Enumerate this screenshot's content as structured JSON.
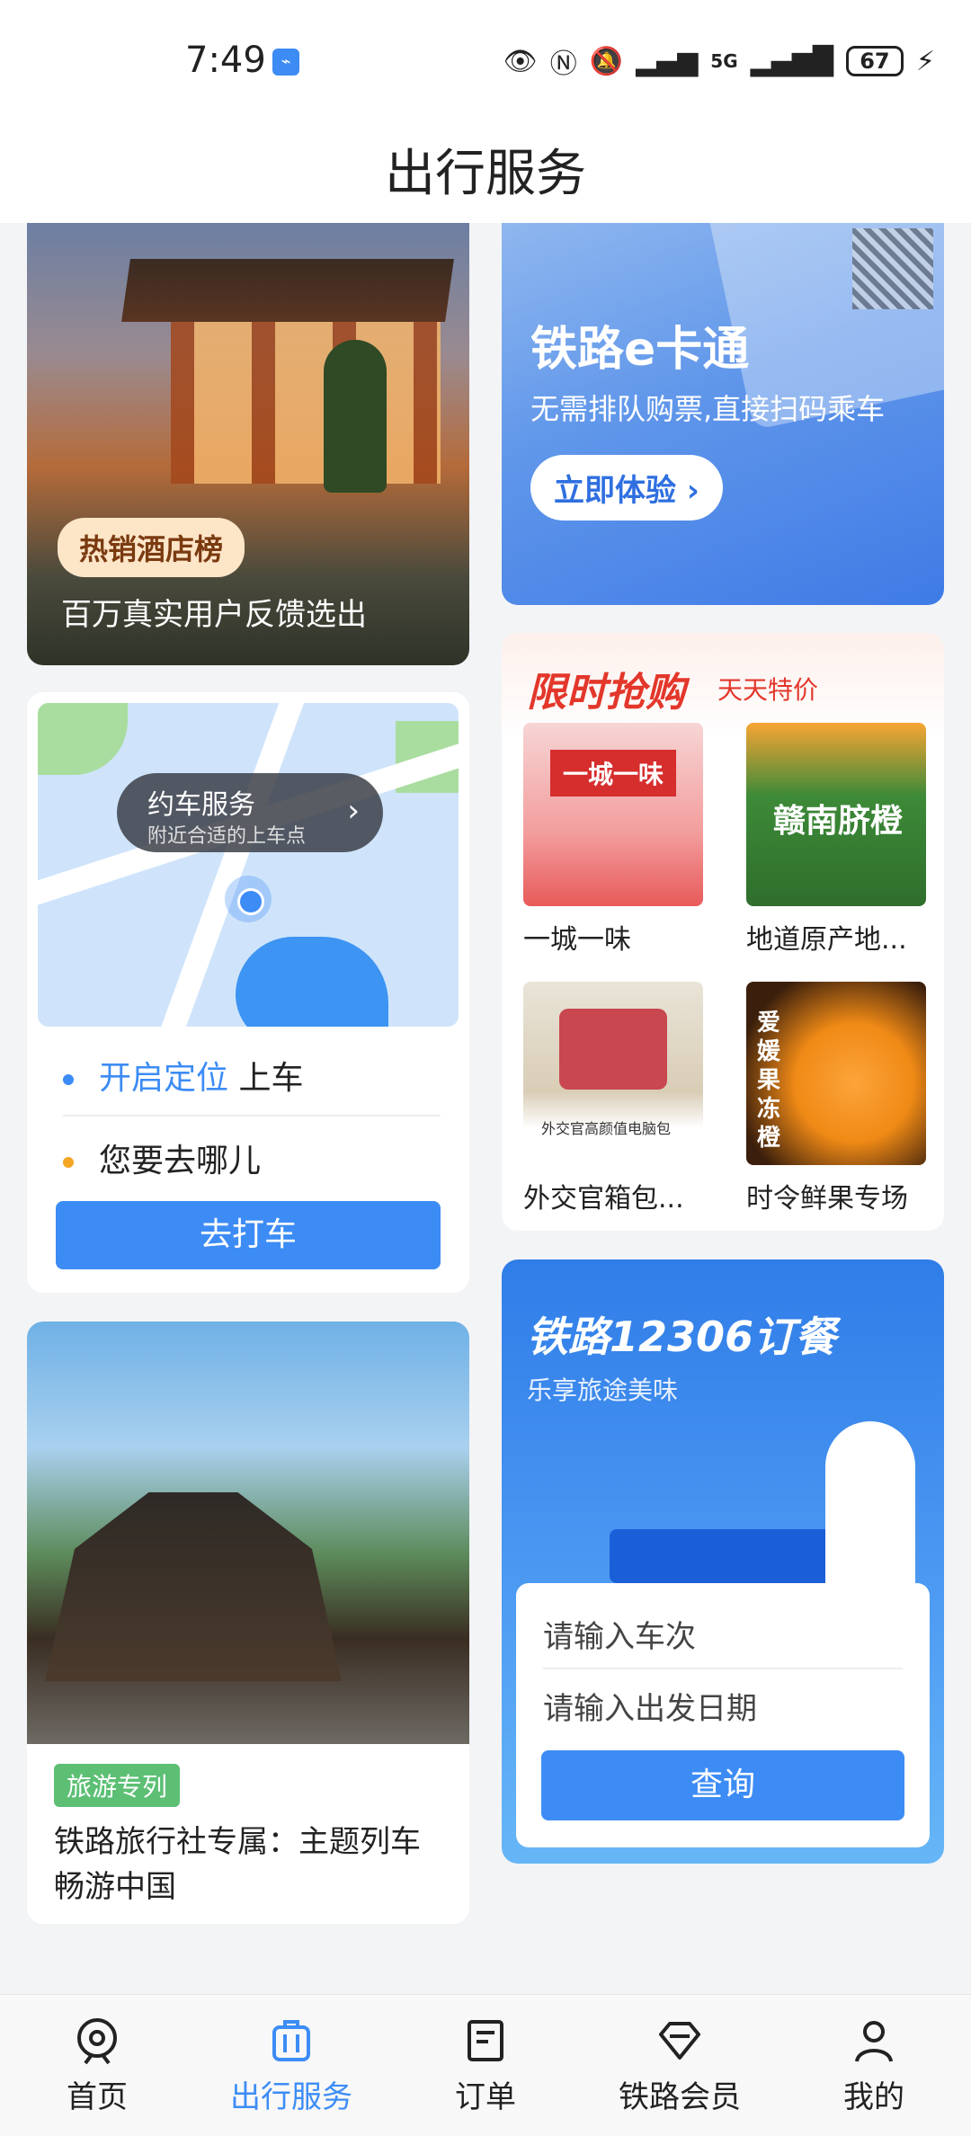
{
  "status": {
    "time": "7:49",
    "network": "5G",
    "battery": "67"
  },
  "header": {
    "title": "出行服务"
  },
  "hotel": {
    "badge": "热销酒店榜",
    "subtitle": "百万真实用户反馈选出"
  },
  "ecard": {
    "title": "铁路e卡通",
    "subtitle": "无需排队购票,直接扫码乘车",
    "button": "立即体验"
  },
  "taxi": {
    "bubble_title": "约车服务",
    "bubble_sub": "附近合适的上车点",
    "locate_link": "开启定位",
    "locate_suffix": "上车",
    "destination": "您要去哪儿",
    "button": "去打车"
  },
  "flash": {
    "title": "限时抢购",
    "tag": "天天特价",
    "products": [
      {
        "name": "一城一味",
        "img_text": "一城一味"
      },
      {
        "name": "地道原产地...",
        "img_text": "赣南脐橙"
      },
      {
        "name": "外交官箱包...",
        "img_text": "外交官高颜值电脑包"
      },
      {
        "name": "时令鲜果专场",
        "img_text": "爱媛果冻橙"
      }
    ]
  },
  "tour": {
    "tag": "旅游专列",
    "text": "铁路旅行社专属：主题列车畅游中国"
  },
  "meal": {
    "title": "铁路12306订餐",
    "subtitle": "乐享旅途美味",
    "train_placeholder": "请输入车次",
    "date_placeholder": "请输入出发日期",
    "button": "查询"
  },
  "tabs": [
    {
      "label": "首页",
      "icon": "train-icon"
    },
    {
      "label": "出行服务",
      "icon": "suitcase-icon"
    },
    {
      "label": "订单",
      "icon": "order-icon"
    },
    {
      "label": "铁路会员",
      "icon": "diamond-icon"
    },
    {
      "label": "我的",
      "icon": "profile-icon"
    }
  ],
  "colors": {
    "accent": "#3d8cf5",
    "sale_red": "#e3372b"
  }
}
